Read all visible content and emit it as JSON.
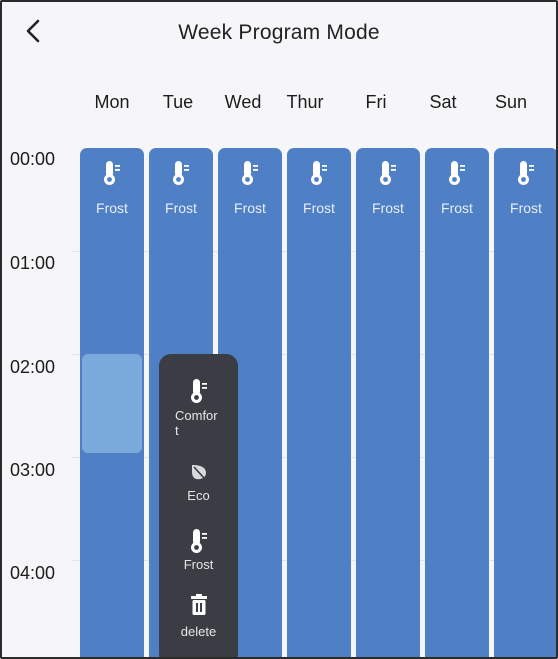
{
  "header": {
    "title": "Week Program Mode"
  },
  "days": [
    "Mon",
    "Tue",
    "Wed",
    "Thur",
    "Fri",
    "Sat",
    "Sun"
  ],
  "hours": [
    "00:00",
    "01:00",
    "02:00",
    "03:00",
    "04:00"
  ],
  "schedule": {
    "slot_label": "Frost",
    "slot_icon": "thermometer-icon",
    "colors": {
      "slot": "#4f7fc4",
      "selected": "#7aaadc",
      "menu": "#3b3d45"
    }
  },
  "menu": {
    "comfort": {
      "label": "Comfort",
      "icon": "thermometer-icon"
    },
    "eco": {
      "label": "Eco",
      "icon": "leaf-icon"
    },
    "frost": {
      "label": "Frost",
      "icon": "thermometer-icon"
    },
    "delete": {
      "label": "delete",
      "icon": "trash-icon"
    }
  }
}
